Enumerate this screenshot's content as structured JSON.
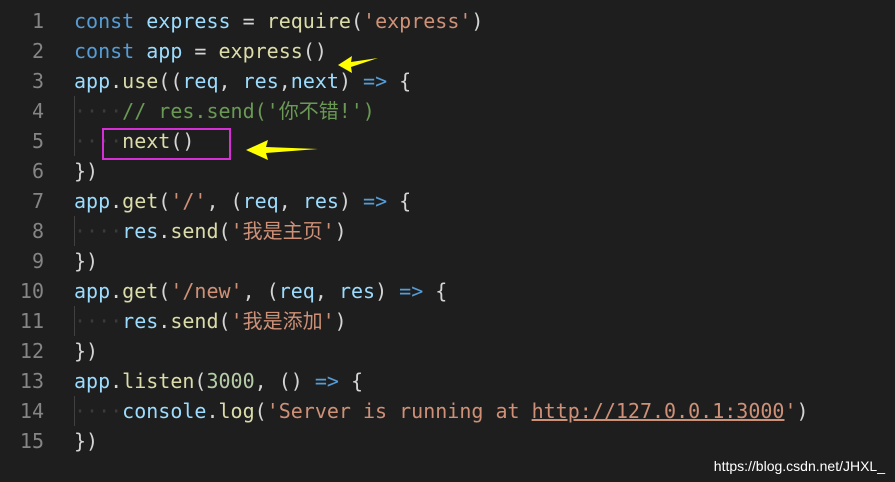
{
  "editor": {
    "lines": [
      {
        "num": "1",
        "tokens": [
          [
            "kw",
            "const"
          ],
          [
            "pun",
            " "
          ],
          [
            "id",
            "express"
          ],
          [
            "pun",
            " = "
          ],
          [
            "fn",
            "require"
          ],
          [
            "pun",
            "("
          ],
          [
            "str",
            "'express'"
          ],
          [
            "pun",
            ")"
          ]
        ]
      },
      {
        "num": "2",
        "tokens": [
          [
            "kw",
            "const"
          ],
          [
            "pun",
            " "
          ],
          [
            "id",
            "app"
          ],
          [
            "pun",
            " = "
          ],
          [
            "fn",
            "express"
          ],
          [
            "pun",
            "()"
          ]
        ]
      },
      {
        "num": "3",
        "tokens": [
          [
            "id",
            "app"
          ],
          [
            "pun",
            "."
          ],
          [
            "fn",
            "use"
          ],
          [
            "pun",
            "(("
          ],
          [
            "id",
            "req"
          ],
          [
            "pun",
            ", "
          ],
          [
            "id",
            "res"
          ],
          [
            "pun",
            ","
          ],
          [
            "id",
            "next"
          ],
          [
            "pun",
            ") "
          ],
          [
            "kw",
            "=>"
          ],
          [
            "pun",
            " {"
          ]
        ]
      },
      {
        "num": "4",
        "tokens": [
          [
            "dots",
            "····"
          ],
          [
            "com",
            "// res.send('你不错!')"
          ]
        ]
      },
      {
        "num": "5",
        "tokens": [
          [
            "dots",
            "····"
          ],
          [
            "fn",
            "next"
          ],
          [
            "pun",
            "()"
          ]
        ]
      },
      {
        "num": "6",
        "tokens": [
          [
            "pun",
            "})"
          ]
        ]
      },
      {
        "num": "7",
        "tokens": [
          [
            "id",
            "app"
          ],
          [
            "pun",
            "."
          ],
          [
            "fn",
            "get"
          ],
          [
            "pun",
            "("
          ],
          [
            "str",
            "'/'"
          ],
          [
            "pun",
            ", ("
          ],
          [
            "id",
            "req"
          ],
          [
            "pun",
            ", "
          ],
          [
            "id",
            "res"
          ],
          [
            "pun",
            ") "
          ],
          [
            "kw",
            "=>"
          ],
          [
            "pun",
            " {"
          ]
        ]
      },
      {
        "num": "8",
        "tokens": [
          [
            "dots",
            "····"
          ],
          [
            "id",
            "res"
          ],
          [
            "pun",
            "."
          ],
          [
            "fn",
            "send"
          ],
          [
            "pun",
            "("
          ],
          [
            "str",
            "'我是主页'"
          ],
          [
            "pun",
            ")"
          ]
        ]
      },
      {
        "num": "9",
        "tokens": [
          [
            "pun",
            "})"
          ]
        ]
      },
      {
        "num": "10",
        "tokens": [
          [
            "id",
            "app"
          ],
          [
            "pun",
            "."
          ],
          [
            "fn",
            "get"
          ],
          [
            "pun",
            "("
          ],
          [
            "str",
            "'/new'"
          ],
          [
            "pun",
            ", ("
          ],
          [
            "id",
            "req"
          ],
          [
            "pun",
            ", "
          ],
          [
            "id",
            "res"
          ],
          [
            "pun",
            ") "
          ],
          [
            "kw",
            "=>"
          ],
          [
            "pun",
            " {"
          ]
        ]
      },
      {
        "num": "11",
        "tokens": [
          [
            "dots",
            "····"
          ],
          [
            "id",
            "res"
          ],
          [
            "pun",
            "."
          ],
          [
            "fn",
            "send"
          ],
          [
            "pun",
            "("
          ],
          [
            "str",
            "'我是添加'"
          ],
          [
            "pun",
            ")"
          ]
        ]
      },
      {
        "num": "12",
        "tokens": [
          [
            "pun",
            "})"
          ]
        ]
      },
      {
        "num": "13",
        "tokens": [
          [
            "id",
            "app"
          ],
          [
            "pun",
            "."
          ],
          [
            "fn",
            "listen"
          ],
          [
            "pun",
            "("
          ],
          [
            "num",
            "3000"
          ],
          [
            "pun",
            ", () "
          ],
          [
            "kw",
            "=>"
          ],
          [
            "pun",
            " {"
          ]
        ]
      },
      {
        "num": "14",
        "tokens": [
          [
            "dots",
            "····"
          ],
          [
            "id",
            "console"
          ],
          [
            "pun",
            "."
          ],
          [
            "fn",
            "log"
          ],
          [
            "pun",
            "("
          ],
          [
            "str",
            "'Server is running at "
          ],
          [
            "strlink",
            "http://127.0.0.1:3000"
          ],
          [
            "str",
            "'"
          ],
          [
            "pun",
            ")"
          ]
        ]
      },
      {
        "num": "15",
        "tokens": [
          [
            "pun",
            "})"
          ]
        ]
      }
    ]
  },
  "annotations": {
    "arrow_color": "#ffff00",
    "box_color": "#d62fd6"
  },
  "watermark": "https://blog.csdn.net/JHXL_"
}
